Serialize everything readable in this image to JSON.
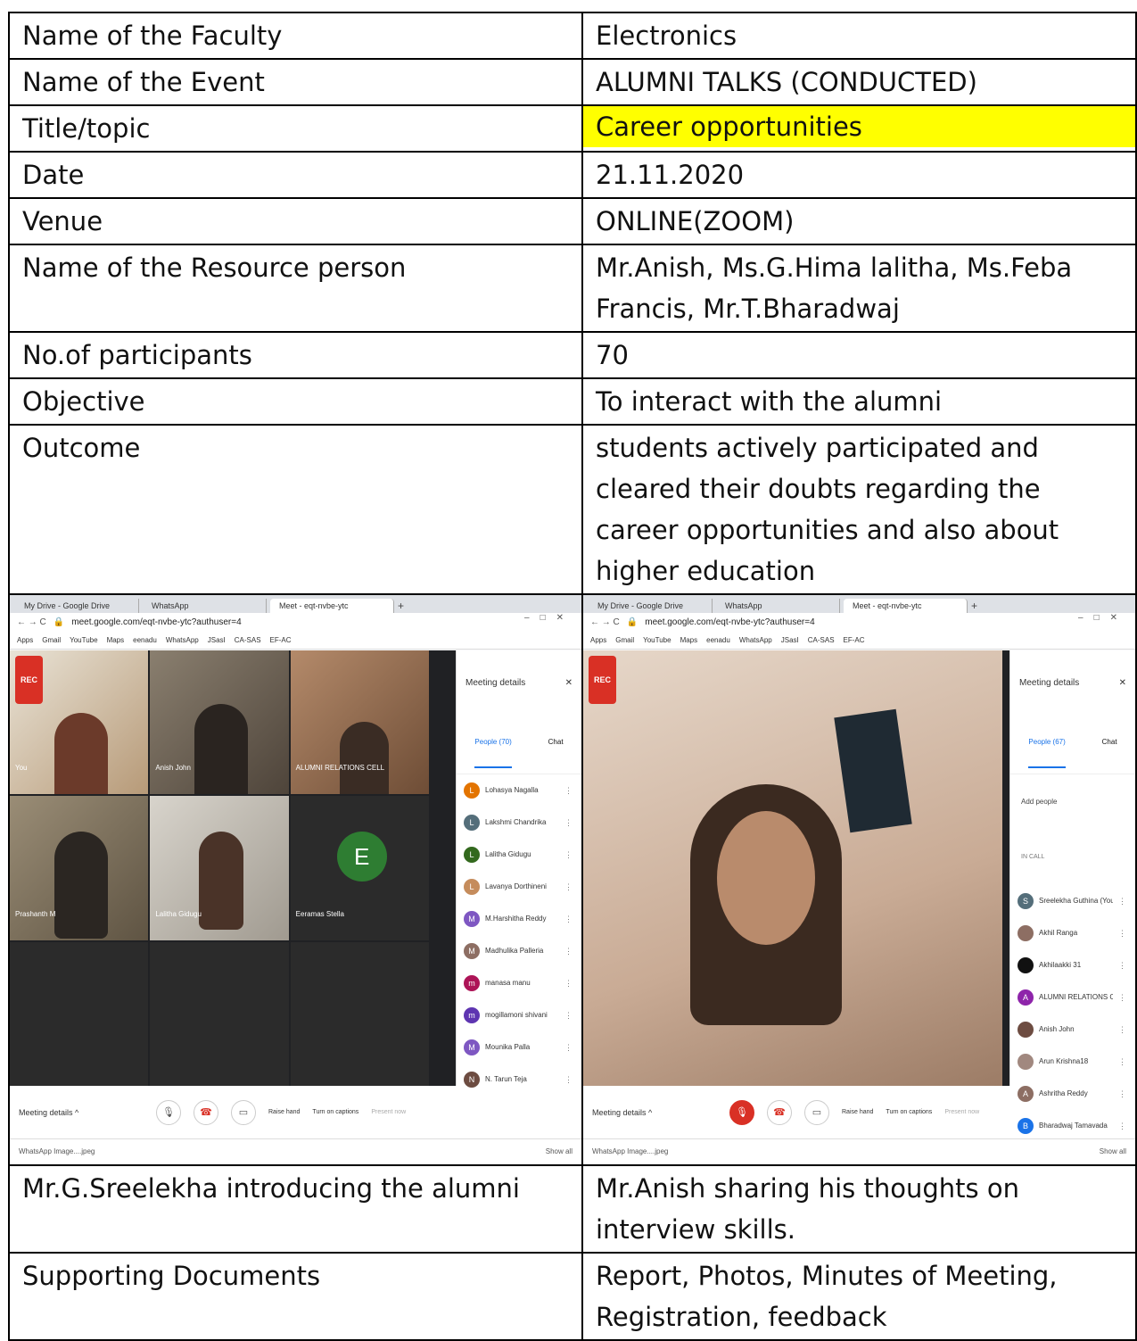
{
  "rows": [
    {
      "label": "Name of the Faculty",
      "value": "Electronics"
    },
    {
      "label": "Name of the Event",
      "value": "ALUMNI TALKS (CONDUCTED)"
    },
    {
      "label": "Title/topic",
      "value": "Career opportunities"
    },
    {
      "label": "Date",
      "value": "21.11.2020"
    },
    {
      "label": "Venue",
      "value": "ONLINE(ZOOM)"
    },
    {
      "label": "Name of the Resource person",
      "value": "Mr.Anish, Ms.G.Hima lalitha, Ms.Feba Francis, Mr.T.Bharadwaj"
    },
    {
      "label": "No.of participants",
      "value": "70"
    },
    {
      "label": "Objective",
      "value": "To interact with the alumni"
    },
    {
      "label": "Outcome",
      "value": "students actively participated and cleared their doubts regarding the career opportunities and also about higher education"
    }
  ],
  "highlight_color": "#ffff00",
  "shot1": {
    "tabs": [
      "My Drive - Google Drive",
      "WhatsApp",
      "Meet - eqt-nvbe-ytc"
    ],
    "url": "meet.google.com/eqt-nvbe-ytc?authuser=4",
    "bookmarks": [
      "Apps",
      "Gmail",
      "YouTube",
      "Maps",
      "eenadu",
      "WhatsApp",
      "JSasI",
      "CA-SAS",
      "EF-AC"
    ],
    "rec": "REC",
    "tiles": [
      "You",
      "Anish John",
      "ALUMNI RELATIONS CELL",
      "Prashanth M",
      "Lalitha Gidugu",
      "Eeramas Stella",
      "",
      "",
      ""
    ],
    "panel_title": "Meeting details",
    "people_tab": "People (70)",
    "chat_tab": "Chat",
    "people": [
      "Lohasya Nagalla",
      "Lakshmi Chandrika",
      "Lalitha Gidugu",
      "Lavanya Dorthineni",
      "M.Harshitha Reddy",
      "Madhulika Palleria",
      "manasa manu",
      "mogillamoni shivani",
      "Mounika Palla",
      "N. Tarun Teja"
    ],
    "meeting_details": "Meeting details ^",
    "raise_hand": "Raise hand",
    "captions": "Turn on captions",
    "present": "Present now",
    "download": "WhatsApp Image....jpeg",
    "show_all": "Show all"
  },
  "shot2": {
    "tabs": [
      "My Drive - Google Drive",
      "WhatsApp",
      "Meet - eqt-nvbe-ytc"
    ],
    "url": "meet.google.com/eqt-nvbe-ytc?authuser=4",
    "bookmarks": [
      "Apps",
      "Gmail",
      "YouTube",
      "Maps",
      "eenadu",
      "WhatsApp",
      "JSasI",
      "CA-SAS",
      "EF-AC"
    ],
    "rec": "REC",
    "panel_title": "Meeting details",
    "people_tab": "People (67)",
    "chat_tab": "Chat",
    "add_people": "Add people",
    "in_call": "IN CALL",
    "people": [
      "Sreelekha Guthina (You)",
      "Akhil Ranga",
      "Akhilaakki 31",
      "ALUMNI RELATIONS CE...",
      "Anish John",
      "Arun Krishna18",
      "Ashritha Reddy",
      "Bharadwaj Tamavada"
    ],
    "meeting_details": "Meeting details ^",
    "raise_hand": "Raise hand",
    "captions": "Turn on captions",
    "present": "Present now",
    "download": "WhatsApp Image....jpeg",
    "show_all": "Show all"
  },
  "caption1": "Mr.G.Sreelekha introducing the alumni",
  "caption2": "Mr.Anish sharing his thoughts on interview skills.",
  "support": {
    "label": "Supporting Documents",
    "value": "Report, Photos, Minutes of Meeting, Registration, feedback"
  }
}
